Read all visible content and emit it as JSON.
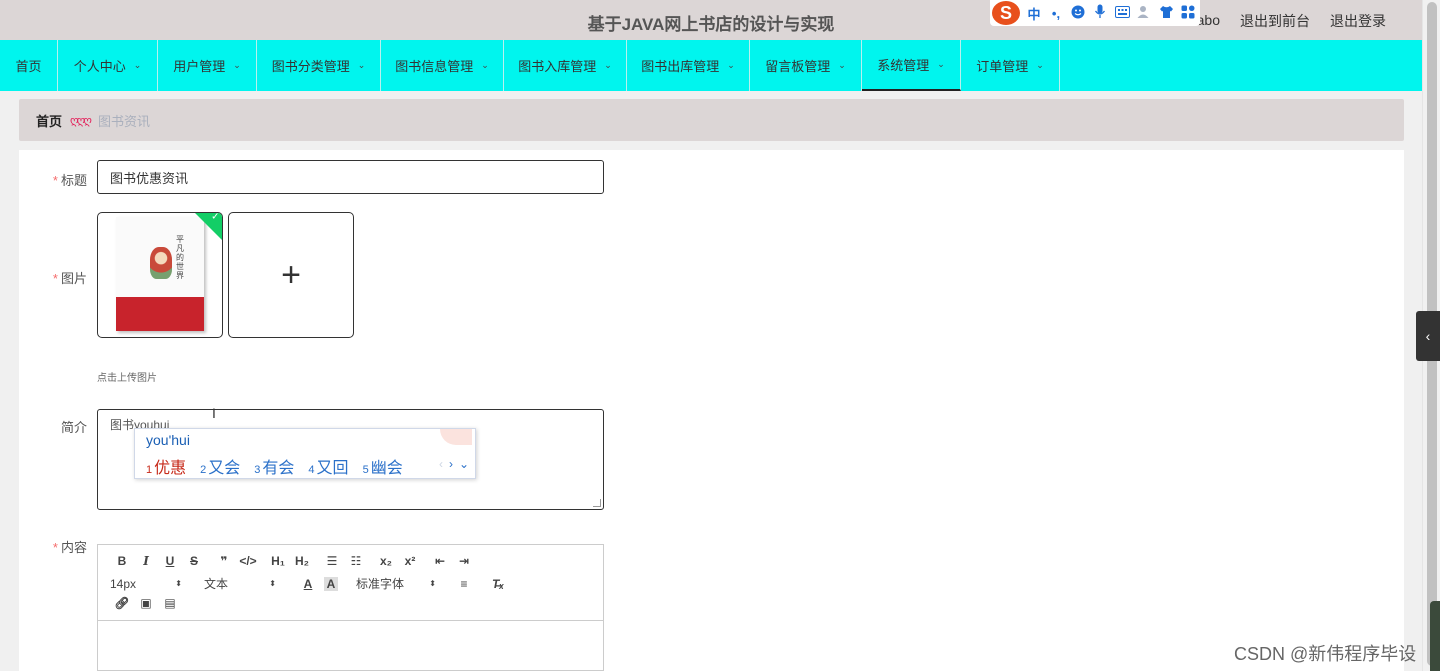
{
  "header": {
    "site_title": "基于JAVA网上书店的设计与实现",
    "user_name": "abo",
    "goto_front_label": "退出到前台",
    "logout_label": "退出登录"
  },
  "ime_bar": {
    "logo": "S",
    "mode": "中",
    "punct": "•,"
  },
  "nav": {
    "items": [
      {
        "label": "首页"
      },
      {
        "label": "个人中心"
      },
      {
        "label": "用户管理"
      },
      {
        "label": "图书分类管理"
      },
      {
        "label": "图书信息管理"
      },
      {
        "label": "图书入库管理"
      },
      {
        "label": "图书出库管理"
      },
      {
        "label": "留言板管理"
      },
      {
        "label": "系统管理"
      },
      {
        "label": "订单管理"
      }
    ]
  },
  "breadcrumb": {
    "home": "首页",
    "separator": "ღღღ",
    "current": "图书资讯"
  },
  "form": {
    "title_label": "标题",
    "title_value": "图书优惠资讯",
    "image_label": "图片",
    "upload_tip": "点击上传图片",
    "plus": "+",
    "intro_label": "简介",
    "intro_value": "图书youhui",
    "content_label": "内容",
    "book_cover_text": "平凡的世界"
  },
  "ime_popup": {
    "pinyin": "you'hui",
    "candidates": [
      {
        "num": "1",
        "text": "优惠"
      },
      {
        "num": "2",
        "text": "又会"
      },
      {
        "num": "3",
        "text": "有会"
      },
      {
        "num": "4",
        "text": "又回"
      },
      {
        "num": "5",
        "text": "幽会"
      }
    ]
  },
  "editor": {
    "font_size": "14px",
    "block_type": "文本",
    "font_family": "标准字体"
  },
  "watermark": "CSDN @新伟程序毕设",
  "colors": {
    "nav_bg": "#00f5ee",
    "header_bg": "#dcd6d6",
    "required": "#f56c6c",
    "success": "#13ce66"
  }
}
